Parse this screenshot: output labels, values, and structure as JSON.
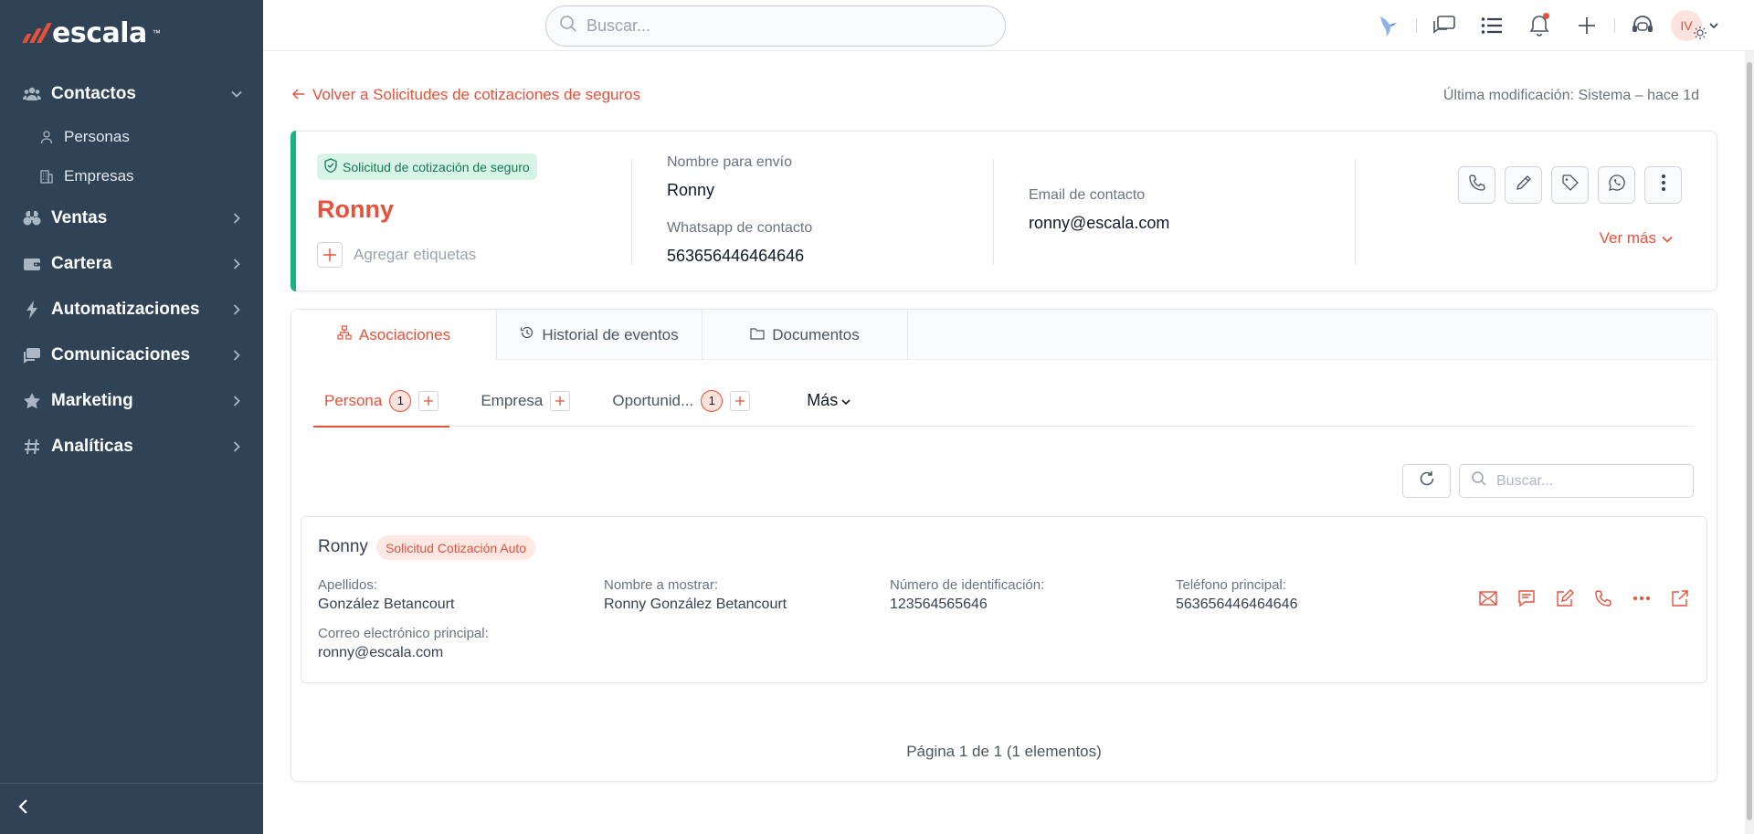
{
  "brand": {
    "name": "escala",
    "tm": "™",
    "accent": "#e8503a",
    "sidebar_bg": "#2f4256"
  },
  "sidebar": {
    "items": [
      {
        "label": "Contactos",
        "icon": "users-icon",
        "expanded": true,
        "children": [
          {
            "label": "Personas",
            "icon": "person-icon"
          },
          {
            "label": "Empresas",
            "icon": "building-icon"
          }
        ]
      },
      {
        "label": "Ventas",
        "icon": "binoculars-icon"
      },
      {
        "label": "Cartera",
        "icon": "wallet-icon"
      },
      {
        "label": "Automatizaciones",
        "icon": "bolt-icon"
      },
      {
        "label": "Comunicaciones",
        "icon": "chat-icon"
      },
      {
        "label": "Marketing",
        "icon": "star-icon"
      },
      {
        "label": "Analíticas",
        "icon": "hash-icon"
      }
    ]
  },
  "topbar": {
    "search_placeholder": "Buscar...",
    "avatar_initials": "IV"
  },
  "page": {
    "back_link": "Volver a Solicitudes de cotizaciones de seguros",
    "modified": "Última modificación: Sistema – hace 1d"
  },
  "record": {
    "type_badge": "Solicitud de cotización de seguro",
    "name": "Ronny",
    "add_tags": "Agregar etiquetas",
    "fields": {
      "nombre_envio_label": "Nombre para envío",
      "nombre_envio_value": "Ronny",
      "whatsapp_label": "Whatsapp de contacto",
      "whatsapp_value": "563656446464646",
      "email_label": "Email de contacto",
      "email_value": "ronny@escala.com"
    },
    "ver_mas": "Ver más"
  },
  "tabs": [
    {
      "label": "Asociaciones",
      "icon": "sitemap-icon",
      "active": true
    },
    {
      "label": "Historial de eventos",
      "icon": "history-icon",
      "active": false
    },
    {
      "label": "Documentos",
      "icon": "folder-icon",
      "active": false
    }
  ],
  "subtabs": [
    {
      "label": "Persona",
      "count": "1",
      "active": true
    },
    {
      "label": "Empresa",
      "count": "",
      "active": false
    },
    {
      "label": "Oportunid...",
      "count": "1",
      "active": false
    }
  ],
  "more_label": "Más",
  "list": {
    "search_placeholder": "Buscar...",
    "item": {
      "name": "Ronny",
      "tag": "Solicitud Cotización Auto",
      "apellidos_label": "Apellidos:",
      "apellidos_value": "González Betancourt",
      "nombre_mostrar_label": "Nombre a mostrar:",
      "nombre_mostrar_value": "Ronny González Betancourt",
      "id_label": "Número de identificación:",
      "id_value": "123564565646",
      "telefono_label": "Teléfono principal:",
      "telefono_value": "563656446464646",
      "correo_label": "Correo electrónico principal:",
      "correo_value": "ronny@escala.com"
    },
    "pagination": "Página 1 de 1 (1 elementos)"
  }
}
